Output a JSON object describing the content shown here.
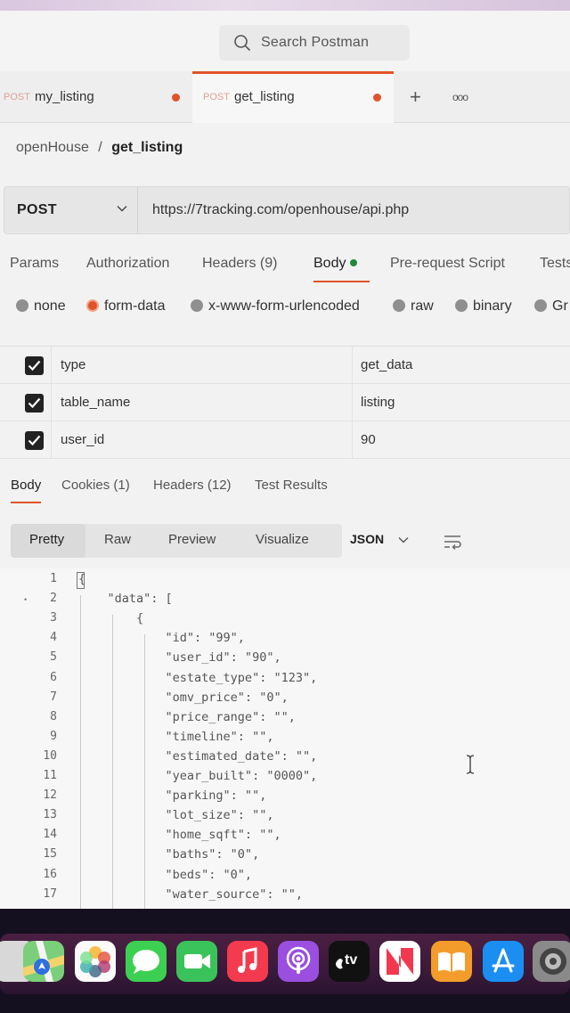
{
  "search": {
    "label": "Search Postman"
  },
  "tabs": [
    {
      "method": "POST",
      "name": "my_listing"
    },
    {
      "method": "POST",
      "name": "get_listing"
    }
  ],
  "tab_actions": {
    "new": "+",
    "more": "ooo"
  },
  "breadcrumb": {
    "collection": "openHouse",
    "separator": "/",
    "request": "get_listing"
  },
  "request": {
    "method": "POST",
    "url": "https://7tracking.com/openhouse/api.php"
  },
  "request_tabs": [
    "Params",
    "Authorization",
    "Headers (9)",
    "Body",
    "Pre-request Script",
    "Tests"
  ],
  "body_types": [
    "none",
    "form-data",
    "x-www-form-urlencoded",
    "raw",
    "binary",
    "Gr"
  ],
  "selected_body_type": "form-data",
  "form_data": [
    {
      "key": "type",
      "value": "get_data"
    },
    {
      "key": "table_name",
      "value": "listing"
    },
    {
      "key": "user_id",
      "value": "90"
    }
  ],
  "response_tabs": [
    "Body",
    "Cookies (1)",
    "Headers (12)",
    "Test Results"
  ],
  "view_modes": [
    "Pretty",
    "Raw",
    "Preview",
    "Visualize"
  ],
  "format": "JSON",
  "code_lines": [
    {
      "n": "1",
      "text": "{"
    },
    {
      "n": "2",
      "text": "    \"data\": ["
    },
    {
      "n": "3",
      "text": "        {"
    },
    {
      "n": "4",
      "text": "            \"id\": \"99\","
    },
    {
      "n": "5",
      "text": "            \"user_id\": \"90\","
    },
    {
      "n": "6",
      "text": "            \"estate_type\": \"123\","
    },
    {
      "n": "7",
      "text": "            \"omv_price\": \"0\","
    },
    {
      "n": "8",
      "text": "            \"price_range\": \"\","
    },
    {
      "n": "9",
      "text": "            \"timeline\": \"\","
    },
    {
      "n": "10",
      "text": "            \"estimated_date\": \"\","
    },
    {
      "n": "11",
      "text": "            \"year_built\": \"0000\","
    },
    {
      "n": "12",
      "text": "            \"parking\": \"\","
    },
    {
      "n": "13",
      "text": "            \"lot_size\": \"\","
    },
    {
      "n": "14",
      "text": "            \"home_sqft\": \"\","
    },
    {
      "n": "15",
      "text": "            \"baths\": \"0\","
    },
    {
      "n": "16",
      "text": "            \"beds\": \"0\","
    },
    {
      "n": "17",
      "text": "            \"water_source\": \"\","
    }
  ],
  "dock": {
    "tv_label": "tv"
  },
  "colors": {
    "accent": "#e0532a",
    "active_dot": "#1e8a3b",
    "dock_bg": "#3a1a3a"
  }
}
